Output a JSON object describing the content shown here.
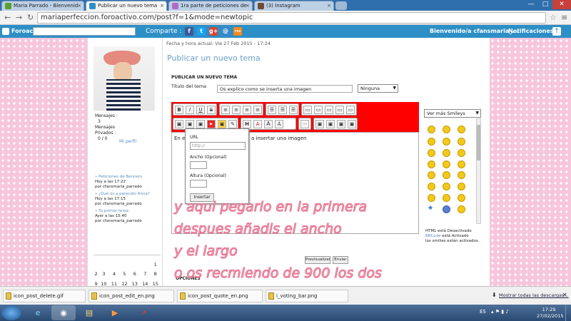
{
  "browser": {
    "tabs": [
      {
        "label": "Maria Parrado - Bienvenid"
      },
      {
        "label": "Publicar un nuevo tema"
      },
      {
        "label": "1ra parte de peticiones de"
      },
      {
        "label": "(3) Instagram"
      }
    ],
    "url": "mariaperfeccion.foroactivo.com/post?f=1&mode=newtopic",
    "window_controls": [
      "—",
      "□",
      "✕"
    ]
  },
  "forum_bar": {
    "brand": "Foroactivo",
    "share_label": "Comparte :",
    "social": [
      "f",
      "t",
      "g+",
      "@",
      "rss"
    ],
    "welcome": "Bienvenido/a cfansmaria_...",
    "notifications": "Notificaciones"
  },
  "sidebar": {
    "stats": {
      "mensajes_label": "Mensajes :",
      "mensajes_value": "3",
      "privados_label1": "Mensajes",
      "privados_label2": "Privados :",
      "privados_value": "0 / 0"
    },
    "profile_link": "Mi perfil",
    "recent": [
      {
        "title": "» Peticiones de Banners",
        "time": "Hoy a las 17:22",
        "by": "por cfansmaria_parrado"
      },
      {
        "title": "» ¿Qué os a parecido Anna?",
        "time": "Hoy a las 17:15",
        "by": "por cfansmaria_parrado"
      },
      {
        "title": "» Tu primer tema",
        "time": "Ayer a las 15:40",
        "by": "por cfansmaria_parrado"
      }
    ],
    "calendar": [
      [
        "",
        "",
        "",
        "",
        "",
        "",
        "1"
      ],
      [
        "2",
        "3",
        "4",
        "5",
        "6",
        "7",
        "8"
      ],
      [
        "9",
        "10",
        "11",
        "12",
        "13",
        "14",
        "15"
      ]
    ]
  },
  "post": {
    "date": "Fecha y hora actual: Vie 27 Feb 2015 - 17:24",
    "page_title": "Publicar un nuevo tema",
    "section_heading": "PUBLICAR UN NUEVO TEMA",
    "title_label": "Título del tema",
    "title_value": "Os explico como se inserta una imagen",
    "type_select": "Ninguna",
    "editor_text_start": "En es",
    "editor_text_end": "a insertar una imagen",
    "toolbar_row1": [
      [
        "B",
        "I",
        "U",
        "S"
      ],
      [
        "≡",
        "≡",
        "≡",
        "≡"
      ],
      [
        "☰",
        "☰",
        "☰"
      ],
      [
        "▭",
        "▭",
        "▭",
        "▭",
        "▭"
      ]
    ],
    "toolbar_row2": [
      [
        "▣",
        "▣",
        "▣",
        "▶",
        "▣",
        "✎"
      ],
      [
        "H",
        "A",
        "A",
        "A"
      ],
      [
        "···"
      ],
      [
        "▣",
        "▣",
        "▣",
        "▣"
      ]
    ],
    "image_popup": {
      "url_label": "URL",
      "url_placeholder": "http://",
      "width_label": "Ancho (Opcional)",
      "height_label": "Altura (Opcional)",
      "insert_button": "Insertar"
    },
    "preview_button": "Previsualizar",
    "send_button": "Enviar",
    "options_label": "OPCIONES"
  },
  "smilies": {
    "dropdown": "Ver más Smileys",
    "html_status": "HTML está Desactivado",
    "bbcode_link": "BBCode",
    "bbcode_status": "está Activado",
    "smilies_status": "los smilies están activados."
  },
  "overlay_text": [
    "y aqui pegarlo en la primera",
    "despues añadis el ancho",
    "y el largo",
    "o os recmiendo de 900 los dos"
  ],
  "downloads": {
    "items": [
      "icon_post_delete.gif",
      "icon_post_edit_en.png",
      "icon_post_quote_en.png",
      "i_voting_bar.png"
    ],
    "show_all": "Mostrar todas las descargas...",
    "close": "✕"
  },
  "taskbar": {
    "lang": "ES",
    "time": "17:29",
    "date": "27/02/2015"
  },
  "colors": {
    "accent": "#2d8fc6",
    "editor_toolbar": "#ff0000",
    "title_blue": "#6aa0c8",
    "overlay_fill": "#f7b3c4"
  }
}
